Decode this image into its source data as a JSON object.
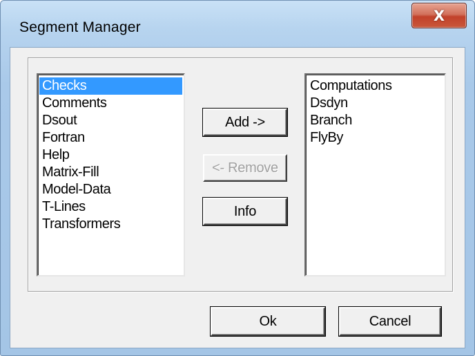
{
  "window": {
    "title": "Segment Manager",
    "close_glyph": "X"
  },
  "available_list": {
    "items": [
      "Checks",
      "Comments",
      "Dsout",
      "Fortran",
      "Help",
      "Matrix-Fill",
      "Model-Data",
      "T-Lines",
      "Transformers"
    ],
    "selected": "Checks"
  },
  "selected_list": {
    "items": [
      "Computations",
      "Dsdyn",
      "Branch",
      "FlyBy"
    ]
  },
  "buttons": {
    "add": "Add ->",
    "remove": "<- Remove",
    "info": "Info",
    "ok": "Ok",
    "cancel": "Cancel"
  },
  "colors": {
    "selection": "#3399ff",
    "dialog_face": "#f0f0f0",
    "frame": "#b7d4ef",
    "close": "#c9583c"
  }
}
